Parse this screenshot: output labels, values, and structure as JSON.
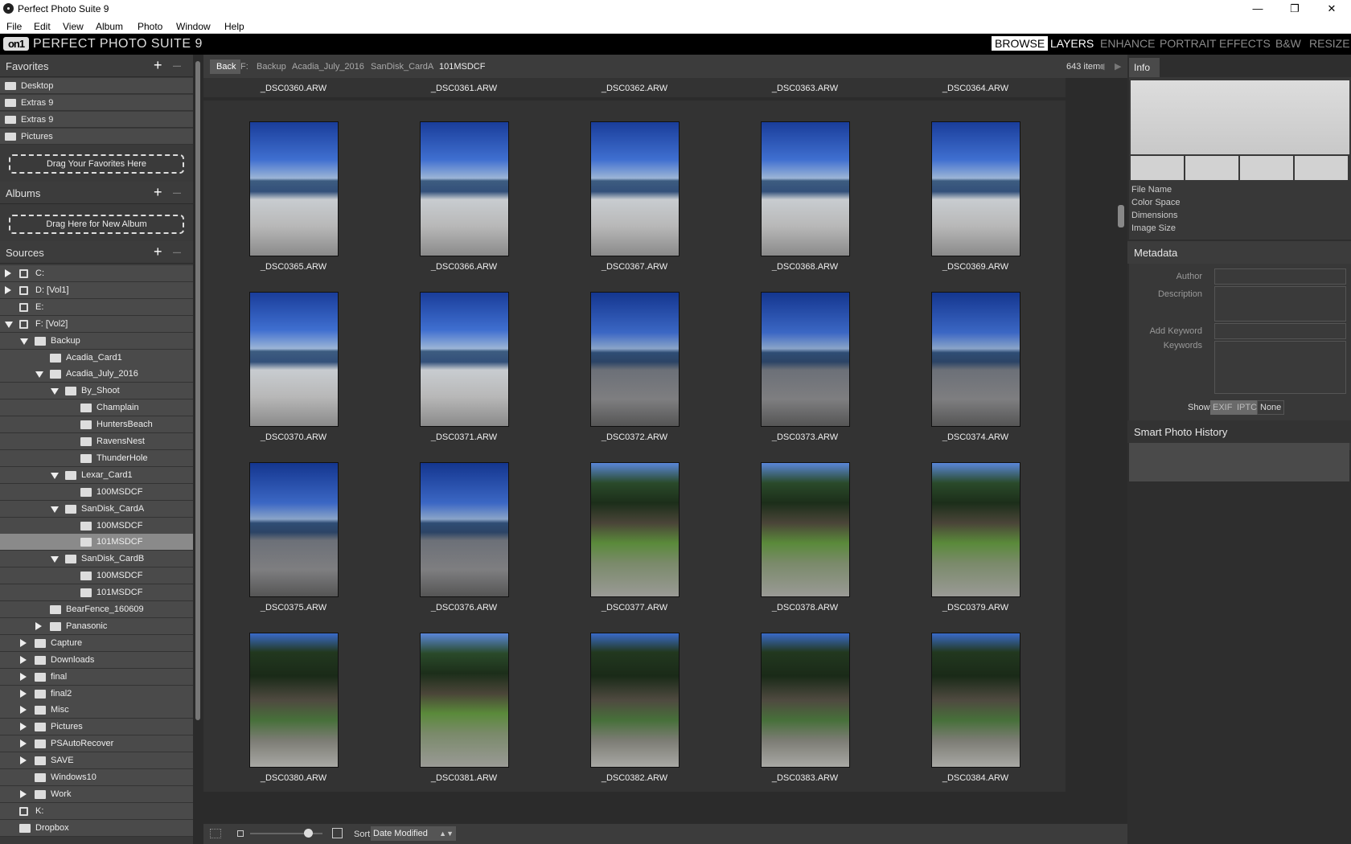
{
  "window": {
    "title": "Perfect Photo Suite 9"
  },
  "menu": [
    "File",
    "Edit",
    "View",
    "Album",
    "Photo",
    "Window",
    "Help"
  ],
  "app": {
    "logo": "on1",
    "title": "PERFECT PHOTO SUITE 9",
    "modules": [
      "BROWSE",
      "LAYERS",
      "ENHANCE",
      "PORTRAIT",
      "EFFECTS",
      "B&W",
      "RESIZE"
    ]
  },
  "favorites": {
    "label": "Favorites",
    "items": [
      "Desktop",
      "Extras 9",
      "Extras 9",
      "Pictures"
    ],
    "drop": "Drag Your Favorites Here"
  },
  "albums": {
    "label": "Albums",
    "drop": "Drag Here for New Album"
  },
  "sources": {
    "label": "Sources"
  },
  "tree": [
    {
      "label": "C:",
      "level": 0,
      "exp": "right",
      "type": "drive"
    },
    {
      "label": "D: [Vol1]",
      "level": 0,
      "exp": "right",
      "type": "drive"
    },
    {
      "label": "E:",
      "level": 0,
      "exp": "",
      "type": "drive"
    },
    {
      "label": "F: [Vol2]",
      "level": 0,
      "exp": "down",
      "type": "drive"
    },
    {
      "label": "Backup",
      "level": 1,
      "exp": "down",
      "type": "folder"
    },
    {
      "label": "Acadia_Card1",
      "level": 2,
      "exp": "",
      "type": "folder"
    },
    {
      "label": "Acadia_July_2016",
      "level": 2,
      "exp": "down",
      "type": "folder"
    },
    {
      "label": "By_Shoot",
      "level": 3,
      "exp": "down",
      "type": "folder"
    },
    {
      "label": "Champlain",
      "level": 4,
      "exp": "",
      "type": "folder"
    },
    {
      "label": "HuntersBeach",
      "level": 4,
      "exp": "",
      "type": "folder"
    },
    {
      "label": "RavensNest",
      "level": 4,
      "exp": "",
      "type": "folder"
    },
    {
      "label": "ThunderHole",
      "level": 4,
      "exp": "",
      "type": "folder"
    },
    {
      "label": "Lexar_Card1",
      "level": 3,
      "exp": "down",
      "type": "folder"
    },
    {
      "label": "100MSDCF",
      "level": 4,
      "exp": "",
      "type": "folder"
    },
    {
      "label": "SanDisk_CardA",
      "level": 3,
      "exp": "down",
      "type": "folder"
    },
    {
      "label": "100MSDCF",
      "level": 4,
      "exp": "",
      "type": "folder"
    },
    {
      "label": "101MSDCF",
      "level": 4,
      "exp": "",
      "type": "folder",
      "selected": true
    },
    {
      "label": "SanDisk_CardB",
      "level": 3,
      "exp": "down",
      "type": "folder"
    },
    {
      "label": "100MSDCF",
      "level": 4,
      "exp": "",
      "type": "folder"
    },
    {
      "label": "101MSDCF",
      "level": 4,
      "exp": "",
      "type": "folder"
    },
    {
      "label": "BearFence_160609",
      "level": 2,
      "exp": "",
      "type": "folder"
    },
    {
      "label": "Panasonic",
      "level": 2,
      "exp": "right",
      "type": "folder"
    },
    {
      "label": "Capture",
      "level": 1,
      "exp": "right",
      "type": "folder"
    },
    {
      "label": "Downloads",
      "level": 1,
      "exp": "right",
      "type": "folder"
    },
    {
      "label": "final",
      "level": 1,
      "exp": "right",
      "type": "folder"
    },
    {
      "label": "final2",
      "level": 1,
      "exp": "right",
      "type": "folder"
    },
    {
      "label": "Misc",
      "level": 1,
      "exp": "right",
      "type": "folder"
    },
    {
      "label": "Pictures",
      "level": 1,
      "exp": "right",
      "type": "folder"
    },
    {
      "label": "PSAutoRecover",
      "level": 1,
      "exp": "right",
      "type": "folder"
    },
    {
      "label": "SAVE",
      "level": 1,
      "exp": "right",
      "type": "folder"
    },
    {
      "label": "Windows10",
      "level": 1,
      "exp": "",
      "type": "folder"
    },
    {
      "label": "Work",
      "level": 1,
      "exp": "right",
      "type": "folder"
    },
    {
      "label": "K:",
      "level": 0,
      "exp": "",
      "type": "drive"
    },
    {
      "label": "Dropbox",
      "level": 0,
      "exp": "",
      "type": "dropbox"
    }
  ],
  "breadcrumb": {
    "back": "Back",
    "parts": [
      "F:",
      "Backup",
      "Acadia_July_2016",
      "SanDisk_CardA",
      "101MSDCF"
    ],
    "count": "643 items"
  },
  "topcaptions": [
    "_DSC0360.ARW",
    "_DSC0361.ARW",
    "_DSC0362.ARW",
    "_DSC0363.ARW",
    "_DSC0364.ARW"
  ],
  "rows": [
    [
      {
        "name": "_DSC0365.ARW",
        "img": "sea"
      },
      {
        "name": "_DSC0366.ARW",
        "img": "sea"
      },
      {
        "name": "_DSC0367.ARW",
        "img": "sea"
      },
      {
        "name": "_DSC0368.ARW",
        "img": "sea"
      },
      {
        "name": "_DSC0369.ARW",
        "img": "sea"
      }
    ],
    [
      {
        "name": "_DSC0370.ARW",
        "img": "sea"
      },
      {
        "name": "_DSC0371.ARW",
        "img": "sea"
      },
      {
        "name": "_DSC0372.ARW",
        "img": "seadark"
      },
      {
        "name": "_DSC0373.ARW",
        "img": "seadark"
      },
      {
        "name": "_DSC0374.ARW",
        "img": "seadark"
      }
    ],
    [
      {
        "name": "_DSC0375.ARW",
        "img": "seadark"
      },
      {
        "name": "_DSC0376.ARW",
        "img": "seadark"
      },
      {
        "name": "_DSC0377.ARW",
        "img": "forest"
      },
      {
        "name": "_DSC0378.ARW",
        "img": "forest"
      },
      {
        "name": "_DSC0379.ARW",
        "img": "forest"
      }
    ],
    [
      {
        "name": "_DSC0380.ARW",
        "img": "forest2"
      },
      {
        "name": "_DSC0381.ARW",
        "img": "forest"
      },
      {
        "name": "_DSC0382.ARW",
        "img": "forest2"
      },
      {
        "name": "_DSC0383.ARW",
        "img": "forest2"
      },
      {
        "name": "_DSC0384.ARW",
        "img": "forest2"
      }
    ]
  ],
  "bottom": {
    "sort_label": "Sort",
    "sort_value": "Date Modified"
  },
  "info": {
    "tab": "Info",
    "fields": [
      "File Name",
      "Color Space",
      "Dimensions",
      "Image Size"
    ]
  },
  "metadata": {
    "label": "Metadata",
    "fields": [
      "Author",
      "Description",
      "Add Keyword",
      "Keywords"
    ],
    "show_label": "Show",
    "show_options": [
      "EXIF",
      "IPTC",
      "None"
    ]
  },
  "history": {
    "label": "Smart Photo History"
  }
}
